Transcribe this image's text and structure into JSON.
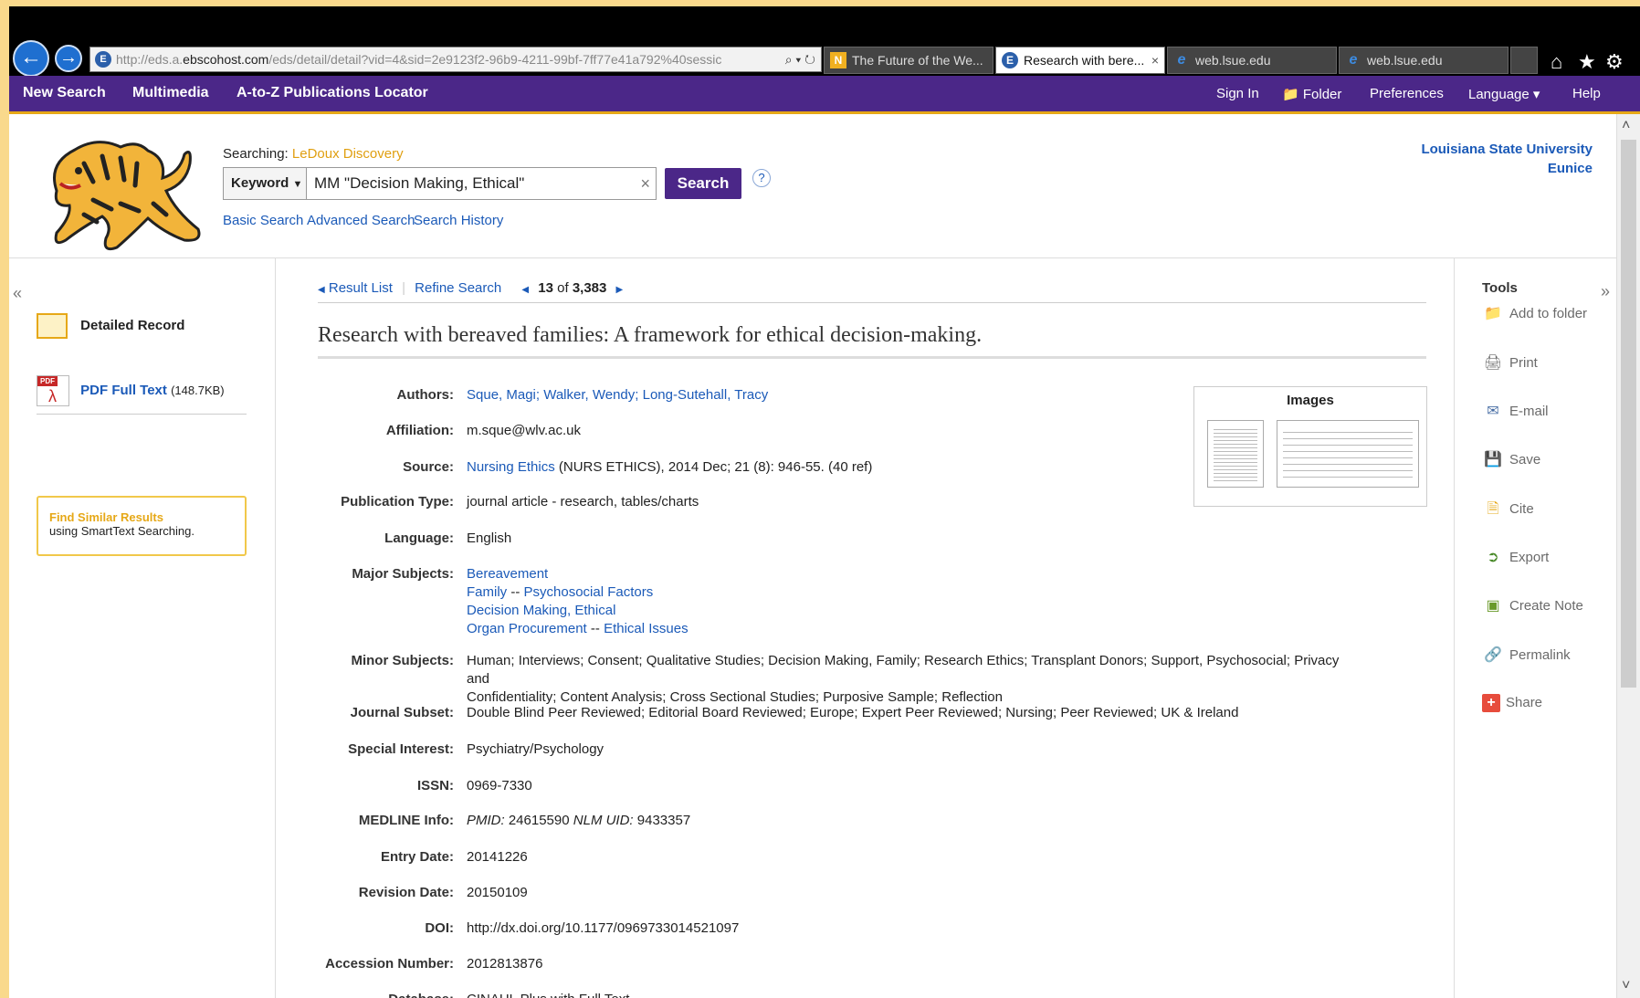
{
  "browser": {
    "url_prefix": "http://eds.a.",
    "url_host": "ebscohost.com",
    "url_rest": "/eds/detail/detail?vid=4&sid=2e9123f2-96b9-4211-99bf-7ff77e41a792%40sessic",
    "url_tools": "⌕ ▾ ↻",
    "tabs": [
      {
        "label": "The Future of the We...",
        "icon": "N"
      },
      {
        "label": "Research with bere...",
        "icon": "E",
        "close": "×"
      },
      {
        "label": "web.lsue.edu",
        "icon": "e"
      },
      {
        "label": "web.lsue.edu",
        "icon": "e"
      }
    ]
  },
  "topnav": {
    "left": [
      "New Search",
      "Multimedia",
      "A-to-Z Publications Locator"
    ],
    "right": {
      "sign_in": "Sign In",
      "folder": "Folder",
      "preferences": "Preferences",
      "language": "Language ▾",
      "help": "Help"
    }
  },
  "header": {
    "searching_label": "Searching:",
    "searching_source": "LeDoux Discovery",
    "field_select": "Keyword",
    "query": "MM \"Decision Making, Ethical\"",
    "clear": "×",
    "search_button": "Search",
    "help": "?",
    "links": [
      "Basic Search",
      "Advanced Search",
      "Search History"
    ],
    "institution_line1": "Louisiana State University",
    "institution_line2": "Eunice"
  },
  "left": {
    "collapse": "«",
    "detailed_record": "Detailed Record",
    "pdf_label": "PDF Full Text",
    "pdf_size": "(148.7KB)",
    "pdf_badge": "PDF",
    "find_similar_title": "Find Similar Results",
    "find_similar_sub": "using SmartText Searching."
  },
  "main": {
    "result_list": "Result List",
    "refine_search": "Refine Search",
    "position": "13",
    "of": "of",
    "total": "3,383",
    "title": "Research with bereaved families: A framework for ethical decision-making.",
    "images_header": "Images",
    "authors_label": "Authors:",
    "authors": [
      "Sque, Magi",
      "Walker, Wendy",
      "Long-Sutehall, Tracy"
    ],
    "affiliation_label": "Affiliation:",
    "affiliation": "m.sque@wlv.ac.uk",
    "source_label": "Source:",
    "source_link": "Nursing Ethics",
    "source_rest": " (NURS ETHICS), 2014 Dec; 21 (8): 946-55. (40 ref)",
    "pubtype_label": "Publication Type:",
    "pubtype": "journal article - research, tables/charts",
    "language_label": "Language:",
    "language": "English",
    "major_label": "Major Subjects:",
    "major_1": "Bereavement",
    "major_2a": "Family",
    "major_2b": "Psychosocial Factors",
    "major_3": "Decision Making, Ethical",
    "major_4a": "Organ Procurement",
    "major_4b": "Ethical Issues",
    "minor_label": "Minor Subjects:",
    "minor_line1": "Human; Interviews; Consent; Qualitative Studies; Decision Making, Family; Research Ethics; Transplant Donors; Support, Psychosocial; Privacy and",
    "minor_line2": "Confidentiality; Content Analysis; Cross Sectional Studies; Purposive Sample; Reflection",
    "subset_label": "Journal Subset:",
    "subset": "Double Blind Peer Reviewed; Editorial Board Reviewed; Europe; Expert Peer Reviewed; Nursing; Peer Reviewed; UK & Ireland",
    "special_label": "Special Interest:",
    "special": "Psychiatry/Psychology",
    "issn_label": "ISSN:",
    "issn": "0969-7330",
    "medline_label": "MEDLINE Info:",
    "pmid_label": "PMID:",
    "pmid": "24615590",
    "nlm_label": "NLM UID:",
    "nlm": "9433357",
    "entry_label": "Entry Date:",
    "entry": "20141226",
    "revision_label": "Revision Date:",
    "revision": "20150109",
    "doi_label": "DOI:",
    "doi": "http://dx.doi.org/10.1177/0969733014521097",
    "accession_label": "Accession Number:",
    "accession": "2012813876",
    "database_label": "Database:",
    "database": "CINAHL Plus with Full Text"
  },
  "tools": {
    "header": "Tools",
    "expand": "»",
    "items": [
      "Add to folder",
      "Print",
      "E-mail",
      "Save",
      "Cite",
      "Export",
      "Create Note",
      "Permalink",
      "Share"
    ]
  },
  "colors": {
    "nav_purple": "#4b2788",
    "accent_gold": "#e6a817",
    "link_blue": "#1b5ab8",
    "frame": "#f9d98c"
  }
}
